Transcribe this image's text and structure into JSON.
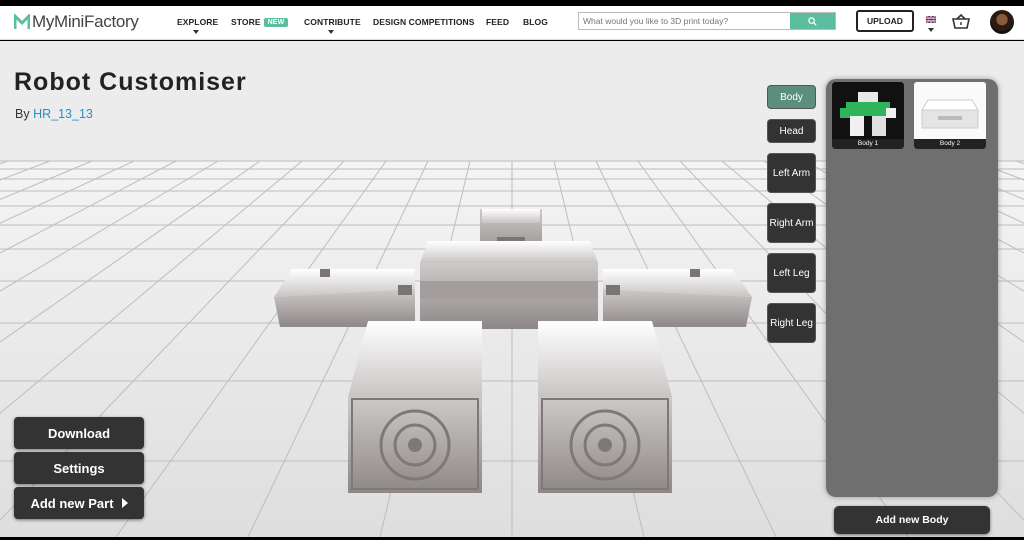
{
  "header": {
    "logo_text": "MyMiniFactory",
    "nav": [
      {
        "label": "EXPLORE",
        "has_caret": true
      },
      {
        "label": "STORE",
        "badge": "NEW",
        "has_caret": false
      },
      {
        "label": "CONTRIBUTE",
        "has_caret": true
      },
      {
        "label": "DESIGN COMPETITIONS",
        "has_caret": false
      },
      {
        "label": "FEED",
        "has_caret": false
      },
      {
        "label": "BLOG",
        "has_caret": false
      }
    ],
    "search_placeholder": "What would you like to 3D print today?",
    "search_icon": "search-icon",
    "upload_label": "UPLOAD",
    "flag_icon": "uk-flag-icon",
    "basket_icon": "basket-icon",
    "accent_color": "#5bbf9f"
  },
  "page": {
    "title": "Robot Customiser",
    "by_label": "By",
    "author": "HR_13_13"
  },
  "part_buttons": [
    {
      "label": "Body",
      "active": true
    },
    {
      "label": "Head",
      "active": false
    },
    {
      "label": "Left Arm",
      "active": false
    },
    {
      "label": "Right Arm",
      "active": false
    },
    {
      "label": "Left Leg",
      "active": false
    },
    {
      "label": "Right Leg",
      "active": false
    }
  ],
  "panel": {
    "options": [
      {
        "label": "Body 1"
      },
      {
        "label": "Body 2"
      }
    ],
    "add_label": "Add new Body"
  },
  "actions": {
    "download": "Download",
    "settings": "Settings",
    "add_part": "Add new Part"
  }
}
